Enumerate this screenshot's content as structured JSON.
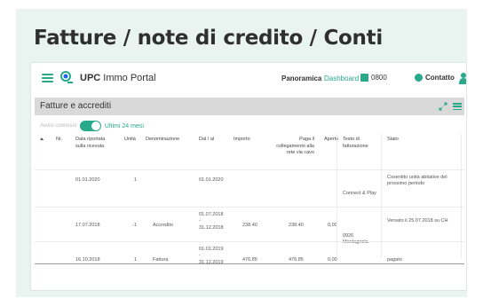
{
  "heading": "Fatture / note di credito / Conti",
  "appbar": {
    "brand_bold": "UPC",
    "brand_rest": " Immo Portal",
    "nav_panoramica": "Panoramica",
    "nav_dashboard": "Dashboard",
    "phone": "0800",
    "contact": "Contatto"
  },
  "panel": {
    "title": "Fatture e accrediti",
    "toggle_label": "Avvisi connessi",
    "toggle_on_label": "Ultimi 24 mesi"
  },
  "table": {
    "headers": {
      "nr": "Nr.",
      "data": "Data riportata sulla ricevuta",
      "unita": "Unità",
      "denominazione": "Denominazione",
      "dal_al": "Dal / al",
      "importo": "Importo",
      "pagamento": "Paga il collegamento alla rete via cavo",
      "aperto": "Aperto",
      "testo": "Testo di fatturazione",
      "stato": "Stato"
    },
    "rows": [
      {
        "data": "01.01.2020",
        "unita": "1",
        "denominazione": "",
        "dal_al": "01.01.2020",
        "importo": "",
        "pagamento": "",
        "aperto": "",
        "testo": "Connect & Play",
        "stato": "Cosentito unità abitative del prossimo periodo"
      },
      {
        "data": "17.07.2018",
        "unita": "-1",
        "denominazione": "Accredito",
        "dal_al_from": "01.07.2018",
        "dal_al_sep": "-",
        "dal_al_to": "31.12.2018",
        "importo": "238.40",
        "pagamento": "238.40",
        "aperto": "0,00",
        "testo": "0926 Montagnola",
        "stato": "Versato il 25.07.2018 su CH"
      },
      {
        "data": "16.10.2018",
        "unita": "1",
        "denominazione": "Fattura",
        "dal_al_from": "01.01.2019",
        "dal_al_sep": "-",
        "dal_al_to": "31.12.2019",
        "importo": "476.85",
        "pagamento": "476.85",
        "aperto": "0,00",
        "testo": "",
        "stato": "pagato"
      }
    ]
  },
  "colors": {
    "accent": "#27a98a",
    "background": "#e9f4f0",
    "panel_header": "#d9d9d9"
  },
  "icons": [
    "hamburger-menu-icon",
    "logo-icon",
    "phone-icon",
    "contact-icon",
    "user-icon",
    "expand-icon",
    "panel-menu-icon",
    "sort-icon"
  ]
}
